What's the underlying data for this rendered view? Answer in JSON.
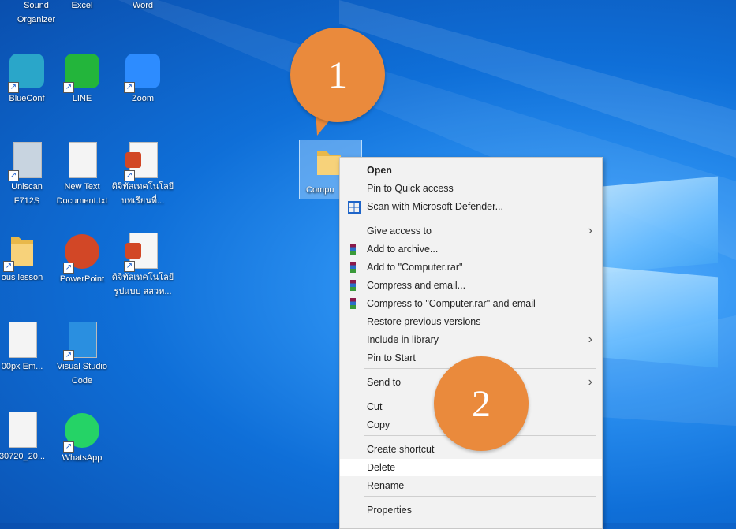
{
  "desktop_icons": [
    {
      "name": "sound-organizer",
      "label": "Sound\nOrganizer",
      "icon": "sound-organizer-icon"
    },
    {
      "name": "excel",
      "label": "Excel",
      "icon": "excel-icon"
    },
    {
      "name": "word",
      "label": "Word",
      "icon": "word-icon"
    },
    {
      "name": "blueconf",
      "label": "BlueConf",
      "icon": "people-icon"
    },
    {
      "name": "line",
      "label": "LINE",
      "icon": "line-icon"
    },
    {
      "name": "zoom",
      "label": "Zoom",
      "icon": "zoom-icon"
    },
    {
      "name": "uniscan",
      "label": "Uniscan\nF712S",
      "icon": "scanner-icon"
    },
    {
      "name": "new-text-document",
      "label": "New Text\nDocument.txt",
      "icon": "text-file-icon"
    },
    {
      "name": "pptx-1",
      "label": "ดิจิทัลเทคโนโลยี\nบทเรียนที่...",
      "icon": "powerpoint-file-icon"
    },
    {
      "name": "folder-lesson",
      "label": "ous lesson",
      "icon": "folder-icon"
    },
    {
      "name": "powerpoint",
      "label": "PowerPoint",
      "icon": "powerpoint-icon"
    },
    {
      "name": "pptx-2",
      "label": "ดิจิทัลเทคโนโลยี\nรูปแบบ สสวท...",
      "icon": "powerpoint-file-icon"
    },
    {
      "name": "image-file",
      "label": "00px Em...",
      "icon": "image-file-icon"
    },
    {
      "name": "vscode",
      "label": "Visual Studio\nCode",
      "icon": "vscode-icon"
    },
    {
      "name": "media-file",
      "label": "30720_20...",
      "icon": "media-file-icon"
    },
    {
      "name": "whatsapp",
      "label": "WhatsApp",
      "icon": "whatsapp-icon"
    }
  ],
  "selected_folder": {
    "label": "Compu",
    "icon": "folder-icon"
  },
  "callouts": [
    "1",
    "2"
  ],
  "context_menu": {
    "items": [
      {
        "label": "Open",
        "bold": true
      },
      {
        "label": "Pin to Quick access"
      },
      {
        "label": "Scan with Microsoft Defender...",
        "icon": "defender-icon"
      },
      {
        "label": "Give access to",
        "submenu": true
      },
      {
        "label": "Add to archive...",
        "icon": "winrar-icon"
      },
      {
        "label": "Add to \"Computer.rar\"",
        "icon": "winrar-icon"
      },
      {
        "label": "Compress and email...",
        "icon": "winrar-icon"
      },
      {
        "label": "Compress to \"Computer.rar\" and email",
        "icon": "winrar-icon"
      },
      {
        "label": "Restore previous versions"
      },
      {
        "label": "Include in library",
        "submenu": true
      },
      {
        "label": "Pin to Start"
      },
      {
        "label": "Send to",
        "submenu": true
      },
      {
        "label": "Cut"
      },
      {
        "label": "Copy"
      },
      {
        "label": "Create shortcut"
      },
      {
        "label": "Delete",
        "highlighted": true
      },
      {
        "label": "Rename"
      },
      {
        "label": "Properties"
      }
    ]
  },
  "colors": {
    "accent": "#ea8a3c",
    "desktop": "#0f6fd8",
    "menu_bg": "#f2f2f2"
  }
}
